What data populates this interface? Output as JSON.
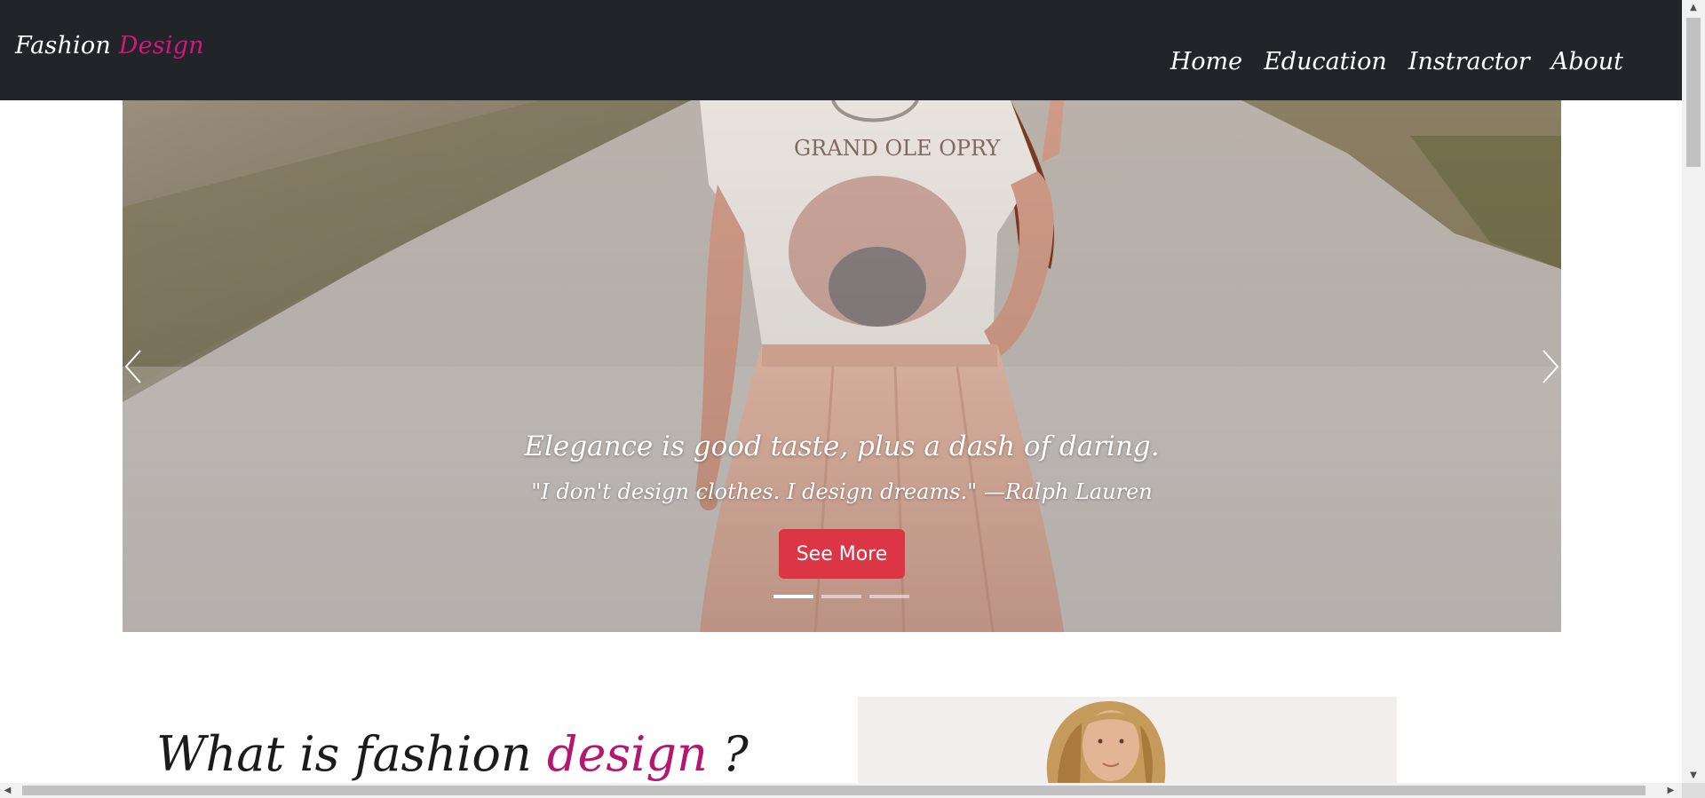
{
  "brand": {
    "part1": "Fashion",
    "part2": "Design",
    "accent_color": "#d4177e"
  },
  "nav": {
    "items": [
      {
        "label": "Home"
      },
      {
        "label": "Education"
      },
      {
        "label": "Instractor"
      },
      {
        "label": "About"
      }
    ]
  },
  "carousel": {
    "title": "Elegance is good taste, plus a dash of daring.",
    "quote": "\"I don't design clothes. I design dreams.\" —Ralph Lauren",
    "button_label": "See More",
    "button_color": "#dc3545",
    "slide_count": 3,
    "active_slide": 1,
    "prev_icon": "chevron-left-icon",
    "next_icon": "chevron-right-icon"
  },
  "section": {
    "title_part1": "What is fashion",
    "title_accent": "design",
    "title_part2": "?",
    "accent_color": "#b5166f"
  },
  "colors": {
    "navbar_bg": "#212529",
    "page_bg": "#ffffff"
  }
}
